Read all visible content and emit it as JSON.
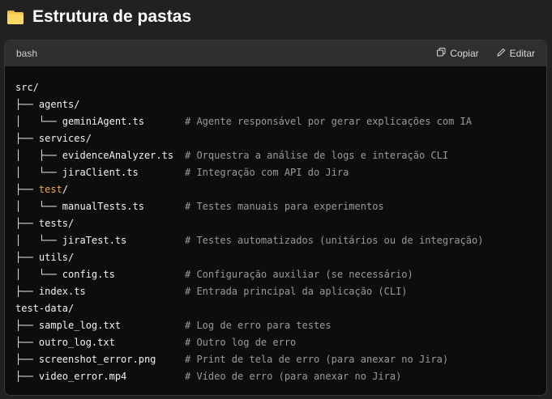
{
  "heading": {
    "text": "Estrutura de pastas",
    "icon": "folder-icon"
  },
  "code": {
    "language": "bash",
    "copy_label": "Copiar",
    "edit_label": "Editar",
    "lines": [
      {
        "prefix": "",
        "name": "src/",
        "comment": ""
      },
      {
        "prefix": "├── ",
        "name": "agents/",
        "comment": ""
      },
      {
        "prefix": "│   └── ",
        "name": "geminiAgent.ts",
        "comment": "# Agente responsável por gerar explicações com IA"
      },
      {
        "prefix": "├── ",
        "name": "services/",
        "comment": ""
      },
      {
        "prefix": "│   ├── ",
        "name": "evidenceAnalyzer.ts",
        "comment": "# Orquestra a análise de logs e interação CLI"
      },
      {
        "prefix": "│   └── ",
        "name": "jiraClient.ts",
        "comment": "# Integração com API do Jira"
      },
      {
        "prefix": "├── ",
        "name": "test",
        "name_suffix": "/",
        "highlight": true,
        "comment": ""
      },
      {
        "prefix": "│   └── ",
        "name": "manualTests.ts",
        "comment": "# Testes manuais para experimentos"
      },
      {
        "prefix": "├── ",
        "name": "tests/",
        "comment": ""
      },
      {
        "prefix": "│   └── ",
        "name": "jiraTest.ts",
        "comment": "# Testes automatizados (unitários ou de integração)"
      },
      {
        "prefix": "├── ",
        "name": "utils/",
        "comment": ""
      },
      {
        "prefix": "│   └── ",
        "name": "config.ts",
        "comment": "# Configuração auxiliar (se necessário)"
      },
      {
        "prefix": "├── ",
        "name": "index.ts",
        "comment": "# Entrada principal da aplicação (CLI)"
      },
      {
        "prefix": "",
        "name": "test-data/",
        "comment": ""
      },
      {
        "prefix": "├── ",
        "name": "sample_log.txt",
        "comment": "# Log de erro para testes"
      },
      {
        "prefix": "├── ",
        "name": "outro_log.txt",
        "comment": "# Outro log de erro"
      },
      {
        "prefix": "├── ",
        "name": "screenshot_error.png",
        "comment": "# Print de tela de erro (para anexar no Jira)"
      },
      {
        "prefix": "├── ",
        "name": "video_error.mp4",
        "comment": "# Vídeo de erro (para anexar no Jira)"
      }
    ]
  },
  "colors": {
    "highlight": "#e9a84c",
    "comment": "#9a9a9a",
    "background": "#212121",
    "code_bg": "#0d0d0d"
  }
}
